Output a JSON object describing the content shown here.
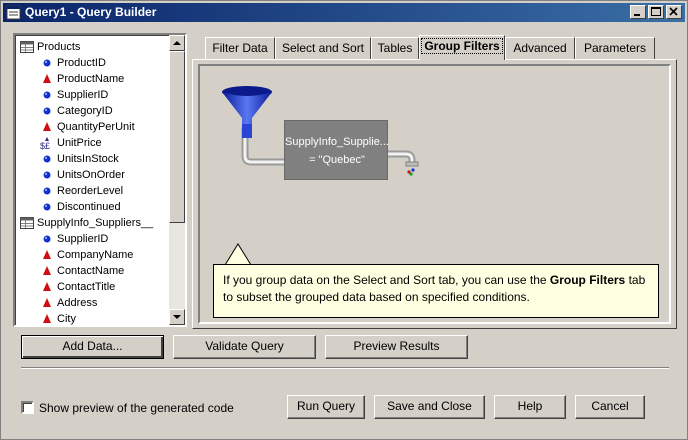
{
  "window": {
    "title": "Query1 - Query Builder",
    "controls": [
      "minimize",
      "maximize",
      "close"
    ]
  },
  "tree": {
    "items": [
      {
        "label": "Products",
        "icon": "table-icon",
        "level": 0
      },
      {
        "label": "ProductID",
        "icon": "numeric-field-icon",
        "level": 1
      },
      {
        "label": "ProductName",
        "icon": "text-field-icon",
        "level": 1
      },
      {
        "label": "SupplierID",
        "icon": "numeric-field-icon",
        "level": 1
      },
      {
        "label": "CategoryID",
        "icon": "numeric-field-icon",
        "level": 1
      },
      {
        "label": "QuantityPerUnit",
        "icon": "text-field-icon",
        "level": 1
      },
      {
        "label": "UnitPrice",
        "icon": "currency-field-icon",
        "level": 1
      },
      {
        "label": "UnitsInStock",
        "icon": "numeric-field-icon",
        "level": 1
      },
      {
        "label": "UnitsOnOrder",
        "icon": "numeric-field-icon",
        "level": 1
      },
      {
        "label": "ReorderLevel",
        "icon": "numeric-field-icon",
        "level": 1
      },
      {
        "label": "Discontinued",
        "icon": "numeric-field-icon",
        "level": 1
      },
      {
        "label": "SupplyInfo_Suppliers__",
        "icon": "table-icon",
        "level": 0
      },
      {
        "label": "SupplierID",
        "icon": "numeric-field-icon",
        "level": 1
      },
      {
        "label": "CompanyName",
        "icon": "text-field-icon",
        "level": 1
      },
      {
        "label": "ContactName",
        "icon": "text-field-icon",
        "level": 1
      },
      {
        "label": "ContactTitle",
        "icon": "text-field-icon",
        "level": 1
      },
      {
        "label": "Address",
        "icon": "text-field-icon",
        "level": 1
      },
      {
        "label": "City",
        "icon": "text-field-icon",
        "level": 1
      }
    ]
  },
  "tabs": [
    {
      "label": "Filter Data",
      "active": false
    },
    {
      "label": "Select and Sort",
      "active": false
    },
    {
      "label": "Tables",
      "active": false
    },
    {
      "label": "Group Filters",
      "active": true
    },
    {
      "label": "Advanced",
      "active": false
    },
    {
      "label": "Parameters",
      "active": false
    }
  ],
  "group_filter": {
    "field": "SupplyInfo_Supplie...",
    "condition": "= \"Quebec\""
  },
  "tip": {
    "text_before": "If you group data on the Select and Sort tab, you can use the ",
    "text_bold": "Group Filters",
    "text_after": " tab",
    "line2": "to subset the grouped data based on specified conditions."
  },
  "actions": {
    "add_data": "Add Data...",
    "validate_query": "Validate Query",
    "preview_results": "Preview Results"
  },
  "footer": {
    "show_preview_label": "Show preview of the generated code",
    "show_preview_checked": false,
    "run_query": "Run Query",
    "save_close": "Save and Close",
    "help": "Help",
    "cancel": "Cancel"
  },
  "colors": {
    "numeric_dot": "#1030d0",
    "text_field": "#d01010",
    "filter_box": "#808080",
    "funnel": "#1a2fd0",
    "tooltip_bg": "#ffffe1"
  }
}
